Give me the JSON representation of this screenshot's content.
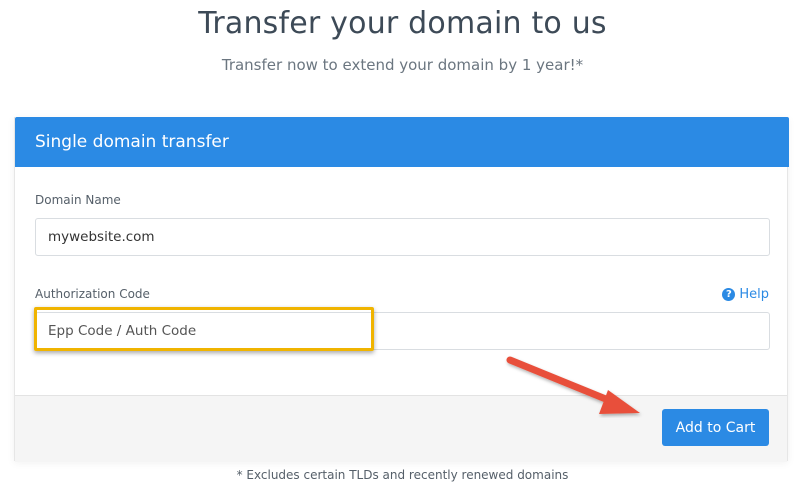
{
  "header": {
    "title": "Transfer your domain to us",
    "subtitle": "Transfer now to extend your domain by 1 year!*"
  },
  "card": {
    "title": "Single domain transfer",
    "domain_field": {
      "label": "Domain Name",
      "value": "mywebsite.com"
    },
    "auth_field": {
      "label": "Authorization Code",
      "placeholder": "Epp Code / Auth Code",
      "help_label": "Help",
      "help_icon": "question-circle-icon"
    },
    "add_to_cart_label": "Add to Cart"
  },
  "footnote": "* Excludes certain TLDs and recently renewed domains",
  "colors": {
    "accent": "#2b8ae4",
    "highlight": "#f0b400",
    "arrow": "#e8503a"
  }
}
